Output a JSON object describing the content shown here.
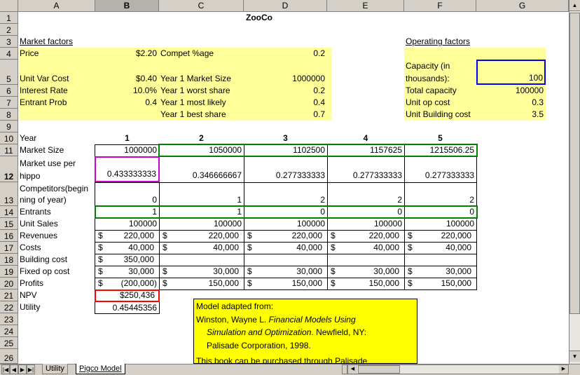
{
  "columns": [
    "A",
    "B",
    "C",
    "D",
    "E",
    "F",
    "G"
  ],
  "rows": [
    "1",
    "2",
    "3",
    "4",
    "5",
    "6",
    "7",
    "8",
    "9",
    "10",
    "11",
    "12",
    "13",
    "14",
    "15",
    "16",
    "17",
    "18",
    "19",
    "20",
    "21",
    "22",
    "23",
    "24",
    "25",
    "26"
  ],
  "title": "ZooCo",
  "market_factors": {
    "heading": "Market factors",
    "price_label": "Price",
    "price": "$2.20",
    "unit_var_cost_label": "Unit Var Cost",
    "unit_var_cost": "$0.40",
    "interest_rate_label": "Interest Rate",
    "interest_rate": "10.0%",
    "entrant_prob_label": "Entrant Prob",
    "entrant_prob": "0.4",
    "compet_label": "Compet %age",
    "compet": "0.2",
    "y1_market_size_label": "Year 1 Market Size",
    "y1_market_size": "1000000",
    "y1_worst_label": "Year 1 worst share",
    "y1_worst": "0.2",
    "y1_likely_label": "Year 1 most likely",
    "y1_likely": "0.4",
    "y1_best_label": "Year 1 best share",
    "y1_best": "0.7"
  },
  "operating_factors": {
    "heading": "Operating factors",
    "capacity_label_1": "Capacity (in",
    "capacity_label_2": "thousands):",
    "capacity": "100",
    "total_capacity_label": "Total capacity",
    "total_capacity": "100000",
    "unit_op_cost_label": "Unit op cost",
    "unit_op_cost": "0.3",
    "unit_building_cost_label": "Unit Building cost",
    "unit_building_cost": "3.5"
  },
  "model": {
    "year_label": "Year",
    "years": [
      "1",
      "2",
      "3",
      "4",
      "5"
    ],
    "market_size_label": "Market Size",
    "market_size": [
      "1000000",
      "1050000",
      "1102500",
      "1157625",
      "1215506.25"
    ],
    "market_use_label_1": "Market use per",
    "market_use_label_2": "hippo",
    "market_use": [
      "0.433333333",
      "0.346666667",
      "0.277333333",
      "0.277333333",
      "0.277333333"
    ],
    "competitors_label_1": "Competitors(begin",
    "competitors_label_2": "ning of year)",
    "competitors": [
      "0",
      "1",
      "2",
      "2",
      "2"
    ],
    "entrants_label": "Entrants",
    "entrants": [
      "1",
      "1",
      "0",
      "0",
      "0"
    ],
    "unit_sales_label": "Unit Sales",
    "unit_sales": [
      "100000",
      "100000",
      "100000",
      "100000",
      "100000"
    ],
    "currency_symbol": "$",
    "revenues_label": "Revenues",
    "revenues": [
      "220,000",
      "220,000",
      "220,000",
      "220,000",
      "220,000"
    ],
    "costs_label": "Costs",
    "costs": [
      "40,000",
      "40,000",
      "40,000",
      "40,000",
      "40,000"
    ],
    "building_cost_label": "Building cost",
    "building_cost": "350,000",
    "fixed_op_cost_label": "Fixed op cost",
    "fixed_op_cost": [
      "30,000",
      "30,000",
      "30,000",
      "30,000",
      "30,000"
    ],
    "profits_label": "Profits",
    "profits": [
      "(200,000)",
      "150,000",
      "150,000",
      "150,000",
      "150,000"
    ],
    "npv_label": "NPV",
    "npv": "$250,436",
    "utility_label": "Utility",
    "utility": "0.45445356"
  },
  "note": {
    "line1": "Model adapted from:",
    "line2_author": "Winston, Wayne L. ",
    "line2_title": "Financial Models Using",
    "line3_title": "Simulation and Optimization",
    "line3_rest": ". Newfield, NY:",
    "line4": "Palisade Corporation, 1998.",
    "line5": "This book can be purchased through Palisade"
  },
  "sheet_tabs": [
    "Utility",
    "Pigco Model"
  ],
  "colors": {
    "yellow_fill": "#ffff99",
    "note_fill": "#ffff00",
    "green_border": "#008000",
    "magenta_border": "#cc00cc",
    "red_border": "#ff0000",
    "blue_border": "#0000ff"
  }
}
